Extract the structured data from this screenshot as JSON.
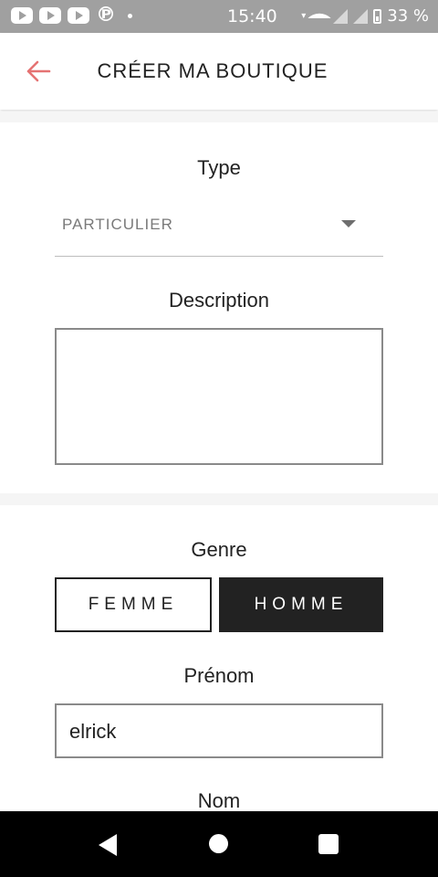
{
  "status_bar": {
    "time": "15:40",
    "battery": "33 %",
    "notification_icons": [
      "youtube-icon",
      "youtube-icon",
      "youtube-icon",
      "p-app-icon",
      "dot-icon"
    ]
  },
  "header": {
    "title": "CRÉER MA BOUTIQUE",
    "back_icon": "arrow-left-icon",
    "accent_color": "#e57373"
  },
  "form": {
    "type": {
      "label": "Type",
      "selected": "PARTICULIER"
    },
    "description": {
      "label": "Description",
      "value": ""
    },
    "genre": {
      "label": "Genre",
      "options": [
        "FEMME",
        "HOMME"
      ],
      "selected": "HOMME"
    },
    "prenom": {
      "label": "Prénom",
      "value": "elrick"
    },
    "nom": {
      "label": "Nom"
    }
  },
  "nav_bar": {
    "buttons": [
      "back-triangle-icon",
      "home-circle-icon",
      "recents-square-icon"
    ]
  }
}
